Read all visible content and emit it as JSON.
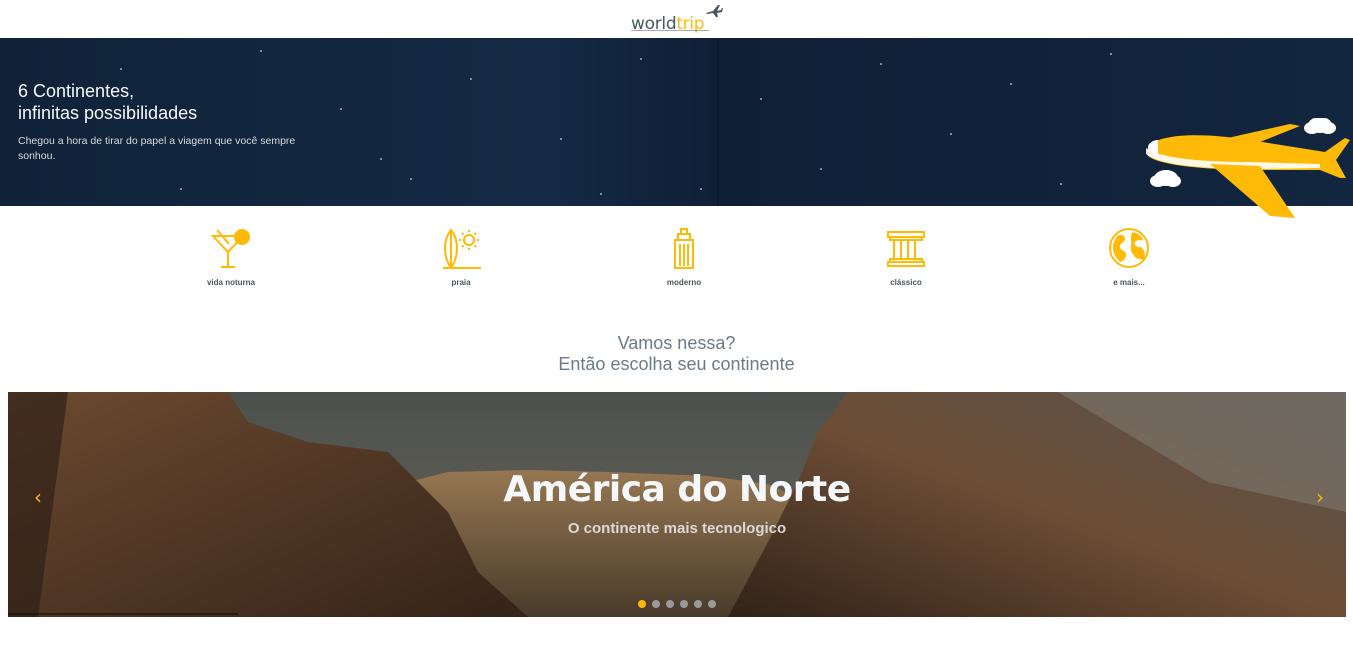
{
  "header": {
    "logo_world": "world",
    "logo_trip": "trip",
    "logo_icon": "airplane-icon"
  },
  "banner": {
    "title_line1": "6 Continentes,",
    "title_line2": "infinitas possibilidades",
    "text": "Chegou a hora de tirar do papel a viagem que você sempre sonhou."
  },
  "travel_types": [
    {
      "label": "vida noturna",
      "icon": "cocktail-icon"
    },
    {
      "label": "praia",
      "icon": "surfboard-sun-icon"
    },
    {
      "label": "moderno",
      "icon": "skyscraper-icon"
    },
    {
      "label": "clássico",
      "icon": "classical-building-icon"
    },
    {
      "label": "e mais...",
      "icon": "globe-icon"
    }
  ],
  "section": {
    "line1": "Vamos nessa?",
    "line2": "Então escolha seu continente"
  },
  "slider": {
    "title": "América do Norte",
    "subtitle": "O continente mais tecnologico",
    "prev_icon": "‹",
    "next_icon": "›",
    "slide_count": 6,
    "active_index": 0
  },
  "colors": {
    "accent": "#ffba08",
    "text_dark": "#47585b",
    "banner_bg": "#0f2238"
  }
}
